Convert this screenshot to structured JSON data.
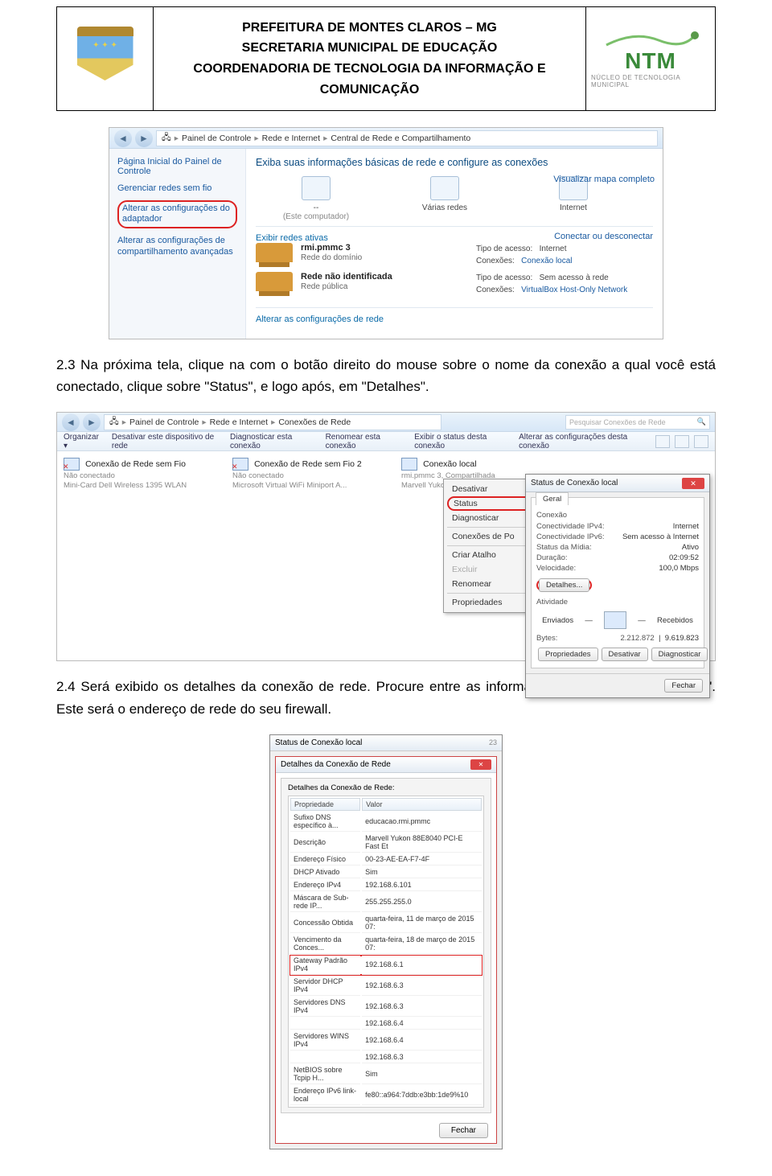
{
  "header": {
    "line1": "PREFEITURA DE MONTES CLAROS – MG",
    "line2": "SECRETARIA MUNICIPAL DE EDUCAÇÃO",
    "line3": "COORDENADORIA DE TECNOLOGIA DA INFORMAÇÃO E",
    "line4": "COMUNICAÇÃO",
    "ntm": "NTM",
    "ntm_sub": "NÚCLEO DE TECNOLOGIA MUNICIPAL"
  },
  "para1": "2.3 Na próxima tela, clique na com o botão direito do mouse sobre o nome da conexão a qual você está conectado, clique sobre \"Status\", e logo após, em \"Detalhes\".",
  "para2_a": "2.4 Será exibido os detalhes da conexão de rede. Procure entre as informações \"Gateway Padrão IPv4\". Este será o endereço de rede do seu firewall.",
  "shot1": {
    "crumb": [
      "Painel de Controle",
      "Rede e Internet",
      "Central de Rede e Compartilhamento"
    ],
    "side_hd": "Página Inicial do Painel de Controle",
    "side_links": [
      "Gerenciar redes sem fio",
      "Alterar as configurações do adaptador",
      "Alterar as configurações de compartilhamento avançadas"
    ],
    "main_title": "Exiba suas informações básicas de rede e configure as conexões",
    "map_link": "Visualizar mapa completo",
    "icons": [
      {
        "name": "--",
        "sub": "(Este computador)"
      },
      {
        "name": "Várias redes",
        "sub": ""
      },
      {
        "name": "Internet",
        "sub": ""
      }
    ],
    "active_title": "Exibir redes ativas",
    "conn_link": "Conectar ou desconectar",
    "nets": [
      {
        "name": "rmi.pmmc 3",
        "sub": "Rede do domínio",
        "meta": {
          "k1": "Tipo de acesso:",
          "v1": "Internet",
          "k2": "Conexões:",
          "v2": "Conexão local"
        }
      },
      {
        "name": "Rede não identificada",
        "sub": "Rede pública",
        "meta": {
          "k1": "Tipo de acesso:",
          "v1": "Sem acesso à rede",
          "k2": "Conexões:",
          "v2": "VirtualBox Host-Only Network"
        }
      }
    ],
    "alter": "Alterar as configurações de rede"
  },
  "shot2": {
    "crumb": [
      "Painel de Controle",
      "Rede e Internet",
      "Conexões de Rede"
    ],
    "search_ph": "Pesquisar Conexões de Rede",
    "toolbar": [
      "Organizar ▾",
      "Desativar este dispositivo de rede",
      "Diagnosticar esta conexão",
      "Renomear esta conexão",
      "Exibir o status desta conexão",
      "Alterar as configurações desta conexão"
    ],
    "cols": [
      {
        "name": "Conexão de Rede sem Fio",
        "st": "Não conectado",
        "dev": "Mini-Card Dell Wireless 1395 WLAN",
        "x": true
      },
      {
        "name": "Conexão de Rede sem Fio 2",
        "st": "Não conectado",
        "dev": "Microsoft Virtual WiFi Miniport A...",
        "x": true
      },
      {
        "name": "Conexão local",
        "st": "rmi.pmmc 3, Compartilhada",
        "dev": "Marvell Yukon 88E8040 PCI-E Fast...",
        "x": false
      }
    ],
    "ctx": [
      "Desativar",
      "Status",
      "Diagnosticar",
      "Conexões de Po",
      "Criar Atalho",
      "Excluir",
      "Renomear",
      "Propriedades"
    ],
    "dlg_title": "Status de Conexão local",
    "dlg_tab": "Geral",
    "dlg_group1": "Conexão",
    "dlg_kv1": [
      {
        "k": "Conectividade IPv4:",
        "v": "Internet"
      },
      {
        "k": "Conectividade IPv6:",
        "v": "Sem acesso à Internet"
      },
      {
        "k": "Status da Mídia:",
        "v": "Ativo"
      },
      {
        "k": "Duração:",
        "v": "02:09:52"
      },
      {
        "k": "Velocidade:",
        "v": "100,0 Mbps"
      }
    ],
    "dlg_details_btn": "Detalhes...",
    "dlg_group2": "Atividade",
    "dlg_sent": "Enviados",
    "dlg_recv": "Recebidos",
    "dlg_bytes_k": "Bytes:",
    "dlg_bytes_s": "2.212.872",
    "dlg_bytes_r": "9.619.823",
    "dlg_btns": [
      "Propriedades",
      "Desativar",
      "Diagnosticar"
    ],
    "dlg_close": "Fechar"
  },
  "shot3": {
    "outer_title": "Status de Conexão local",
    "outer_badge": "23",
    "dlg_title": "Detalhes da Conexão de Rede",
    "caption": "Detalhes da Conexão de Rede:",
    "th1": "Propriedade",
    "th2": "Valor",
    "rows": [
      {
        "k": "Sufixo DNS específico à...",
        "v": "educacao.rmi.pmmc"
      },
      {
        "k": "Descrição",
        "v": "Marvell Yukon 88E8040 PCI-E Fast Et"
      },
      {
        "k": "Endereço Físico",
        "v": "00-23-AE-EA-F7-4F"
      },
      {
        "k": "DHCP Ativado",
        "v": "Sim"
      },
      {
        "k": "Endereço IPv4",
        "v": "192.168.6.101"
      },
      {
        "k": "Máscara de Sub-rede IP...",
        "v": "255.255.255.0"
      },
      {
        "k": "Concessão Obtida",
        "v": "quarta-feira, 11 de março de 2015 07:"
      },
      {
        "k": "Vencimento da Conces...",
        "v": "quarta-feira, 18 de março de 2015 07:"
      },
      {
        "k": "Gateway Padrão IPv4",
        "v": "192.168.6.1",
        "hl": true
      },
      {
        "k": "Servidor DHCP IPv4",
        "v": "192.168.6.3"
      },
      {
        "k": "Servidores DNS IPv4",
        "v": "192.168.6.3"
      },
      {
        "k": "",
        "v": "192.168.6.4"
      },
      {
        "k": "Servidores WINS IPv4",
        "v": "192.168.6.4"
      },
      {
        "k": "",
        "v": "192.168.6.3"
      },
      {
        "k": "NetBIOS sobre Tcpip H...",
        "v": "Sim"
      },
      {
        "k": "Endereço IPv6 link-local",
        "v": "fe80::a964:7ddb:e3bb:1de9%10"
      }
    ],
    "close": "Fechar"
  }
}
